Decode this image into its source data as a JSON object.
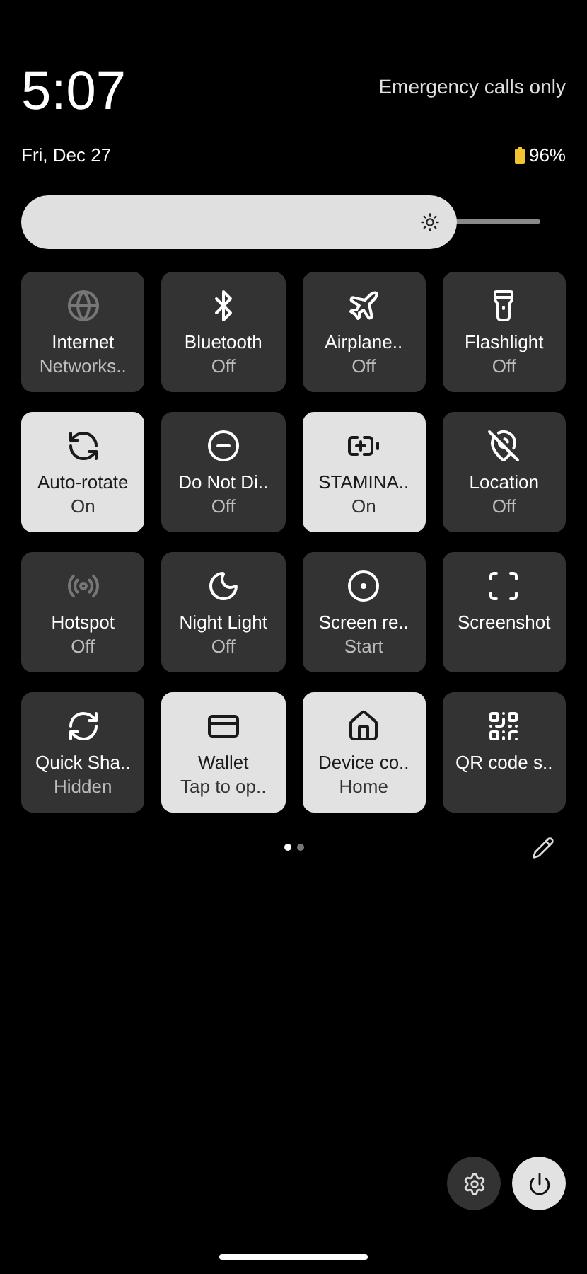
{
  "header": {
    "time": "5:07",
    "carrier": "Emergency calls only",
    "date": "Fri, Dec 27",
    "battery": "96%"
  },
  "brightness": {
    "level": 0.8
  },
  "tiles": [
    {
      "label": "Internet",
      "status": "Networks..",
      "on": false
    },
    {
      "label": "Bluetooth",
      "status": "Off",
      "on": false
    },
    {
      "label": "Airplane..",
      "status": "Off",
      "on": false
    },
    {
      "label": "Flashlight",
      "status": "Off",
      "on": false
    },
    {
      "label": "Auto-rotate",
      "status": "On",
      "on": true
    },
    {
      "label": "Do Not Di..",
      "status": "Off",
      "on": false
    },
    {
      "label": "STAMINA..",
      "status": "On",
      "on": true
    },
    {
      "label": "Location",
      "status": "Off",
      "on": false
    },
    {
      "label": "Hotspot",
      "status": "Off",
      "on": false
    },
    {
      "label": "Night Light",
      "status": "Off",
      "on": false
    },
    {
      "label": "Screen re..",
      "status": "Start",
      "on": false
    },
    {
      "label": "Screenshot",
      "on": false
    },
    {
      "label": "Quick Sha..",
      "status": "Hidden",
      "on": false
    },
    {
      "label": "Wallet",
      "status": "Tap to op..",
      "on": true
    },
    {
      "label": "Device co..",
      "status": "Home",
      "on": true
    },
    {
      "label": "QR code s..",
      "on": false
    }
  ],
  "pages": [
    {
      "selected": true
    },
    {
      "selected": false
    }
  ]
}
